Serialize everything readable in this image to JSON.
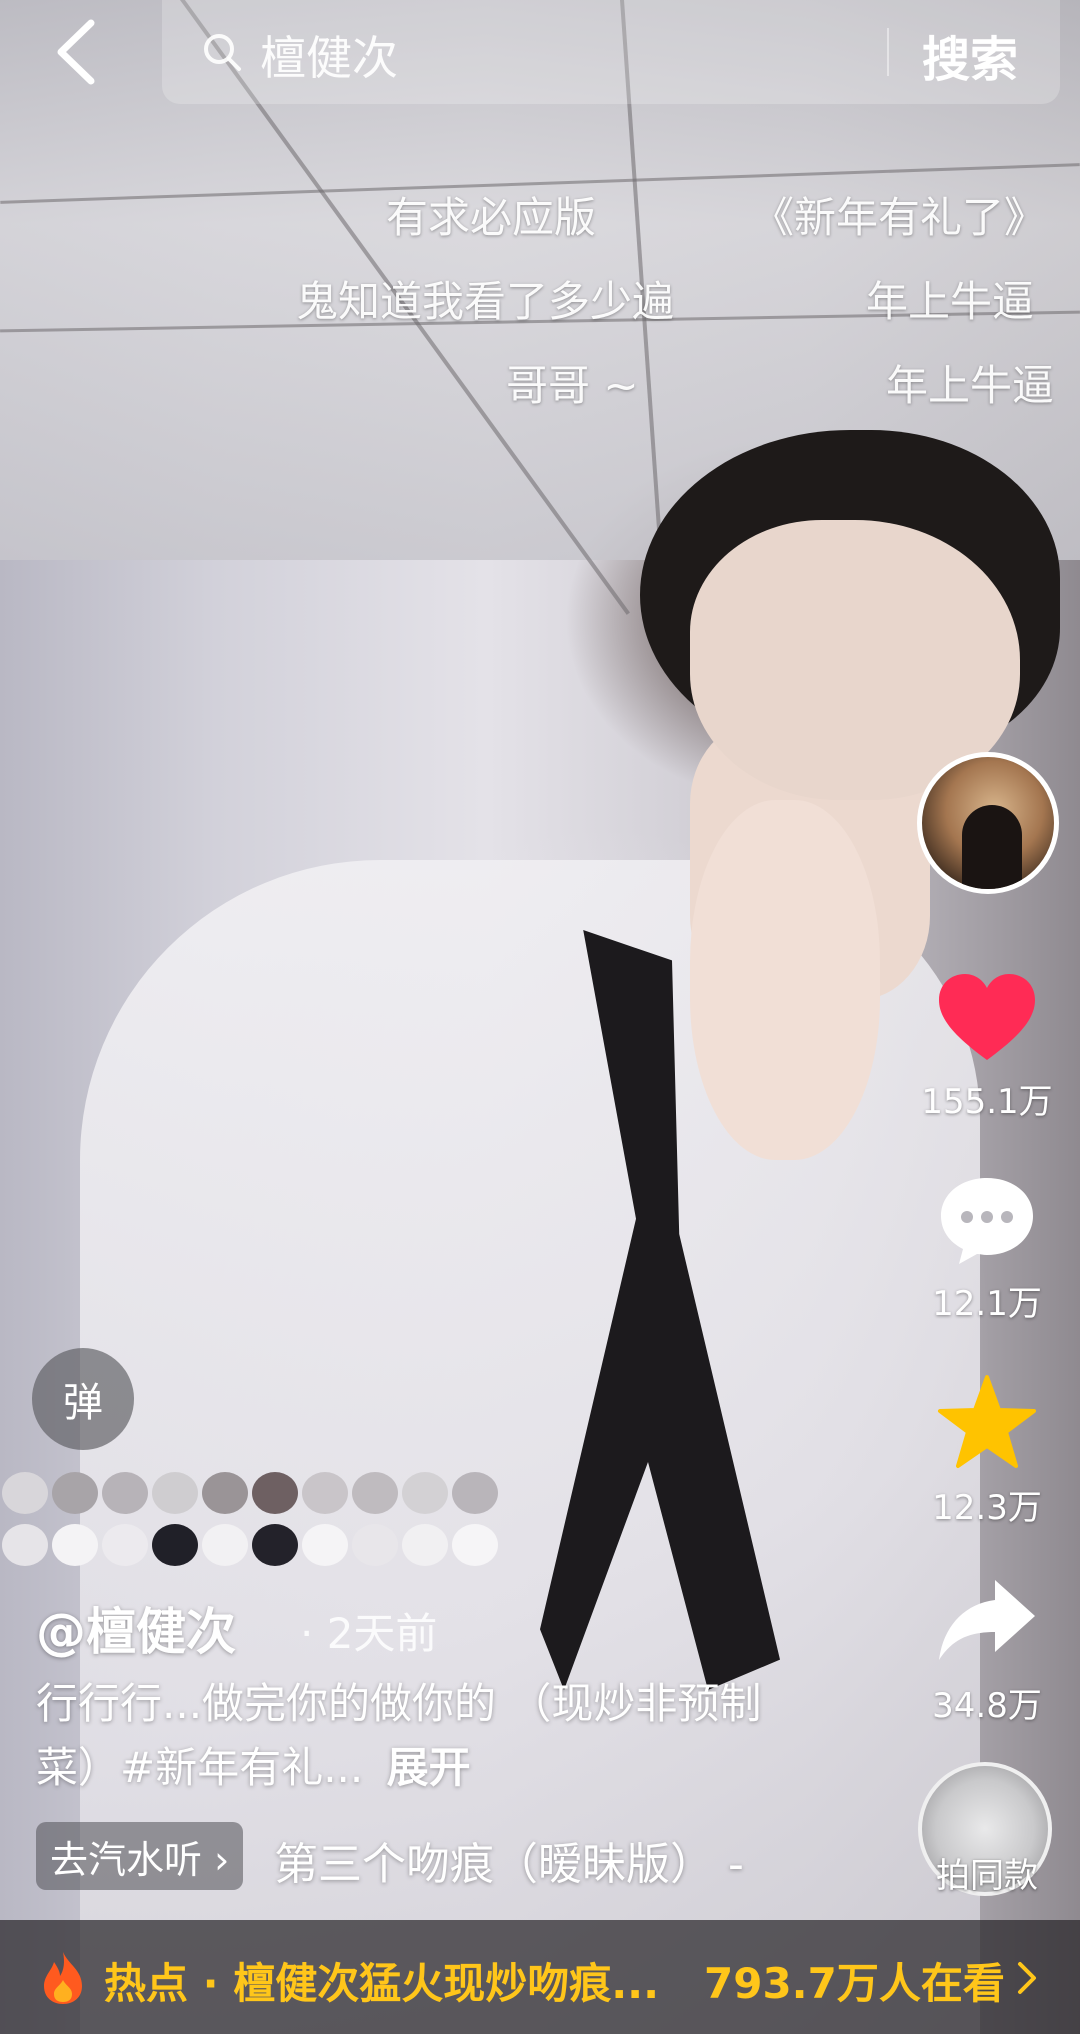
{
  "search": {
    "query": "檀健次",
    "button_label": "搜索"
  },
  "danmaku": [
    "有求必应版",
    "《新年有礼了》",
    "鬼知道我看了多少遍",
    "年上牛逼",
    "哥哥 ~",
    "年上牛逼"
  ],
  "actions": {
    "likes": "155.1万",
    "comments": "12.1万",
    "favorites": "12.3万",
    "shares": "34.8万",
    "same_style_label": "拍同款"
  },
  "colors": {
    "like": "#ff2b55",
    "favorite": "#ffc300",
    "hotspot_text": "#ffc61a"
  },
  "post": {
    "danmaku_toggle": "弹",
    "author": "@檀健次",
    "time": "· 2天前",
    "caption": "行行行...做完你的做你的 （现炒非预制菜）#新年有礼...",
    "expand_label": "展开",
    "music_tag": "去汽水听 ›",
    "music_title": "第三个吻痕（暧昧版） -"
  },
  "hotspot": {
    "label": "热点 · 檀健次猛火现炒吻痕...",
    "viewers": "793.7万人在看"
  }
}
